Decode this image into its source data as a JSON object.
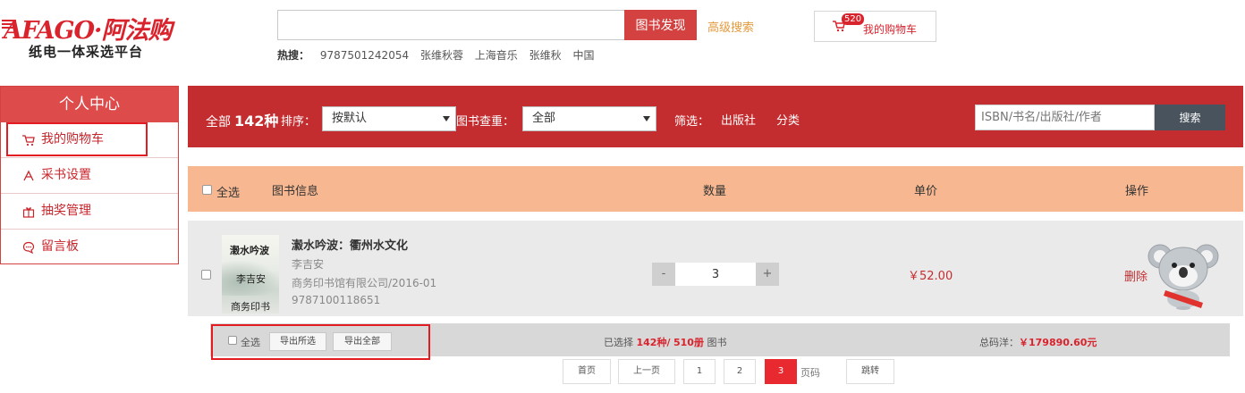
{
  "header": {
    "logo_text": "AFAGO·阿法购",
    "logo_subtitle": "纸电一体采选平台",
    "search": {
      "value": "",
      "button_label": "图书发现"
    },
    "advanced_search_label": "高级搜索",
    "cart": {
      "badge_count": "520",
      "label": "我的购物车"
    },
    "hot": {
      "label": "热搜：",
      "items": [
        "9787501242054",
        "张维秋蓉",
        "上海音乐",
        "张维秋",
        "中国"
      ]
    }
  },
  "sidebar": {
    "title": "个人中心",
    "items": [
      {
        "label": "我的购物车",
        "icon": "cart-icon"
      },
      {
        "label": "采书设置",
        "icon": "settings-icon"
      },
      {
        "label": "抽奖管理",
        "icon": "gift-icon"
      },
      {
        "label": "留言板",
        "icon": "message-icon"
      }
    ]
  },
  "filter_bar": {
    "total_prefix": "全部",
    "total_count": "142种",
    "sort_label": "排序：",
    "sort_value": "按默认",
    "dup_label": "图书查重：",
    "dup_value": "全部",
    "filter_label": "筛选：",
    "filter_publisher": "出版社",
    "filter_category": "分类",
    "isbn_placeholder": "ISBN/书名/出版社/作者",
    "isbn_button": "搜索"
  },
  "table": {
    "select_all": "全选",
    "columns": {
      "info": "图书信息",
      "qty": "数量",
      "price": "单价",
      "action": "操作"
    }
  },
  "book": {
    "cover_line1": "濲水吟波",
    "cover_line2": "李吉安",
    "cover_line3": "商务印书",
    "title": "瀫水吟波：衢州水文化",
    "author": "李吉安",
    "publisher_date": "商务印书馆有限公司/2016-01",
    "isbn": "9787100118651",
    "qty_minus": "-",
    "qty": "3",
    "qty_plus": "+",
    "price": "￥52.00",
    "delete_label": "删除"
  },
  "footer": {
    "select_all": "全选",
    "export_selected": "导出所选",
    "export_all": "导出全部",
    "selected_prefix": "已选择",
    "selected_kinds": "142种/",
    "selected_copies": "510册",
    "selected_suffix": "图书",
    "total_label": "总码洋：",
    "total_value": "￥179890.60元"
  },
  "pagination": {
    "first": "首页",
    "prev": "上一页",
    "pages": [
      "1",
      "2",
      "3"
    ],
    "current": "3",
    "page_label": "页码",
    "jump": "跳转"
  },
  "colors": {
    "brand_red": "#c42d2f",
    "accent_orange": "#f7b891",
    "highlight_red": "#e31c23",
    "search_dark": "#48535d"
  }
}
